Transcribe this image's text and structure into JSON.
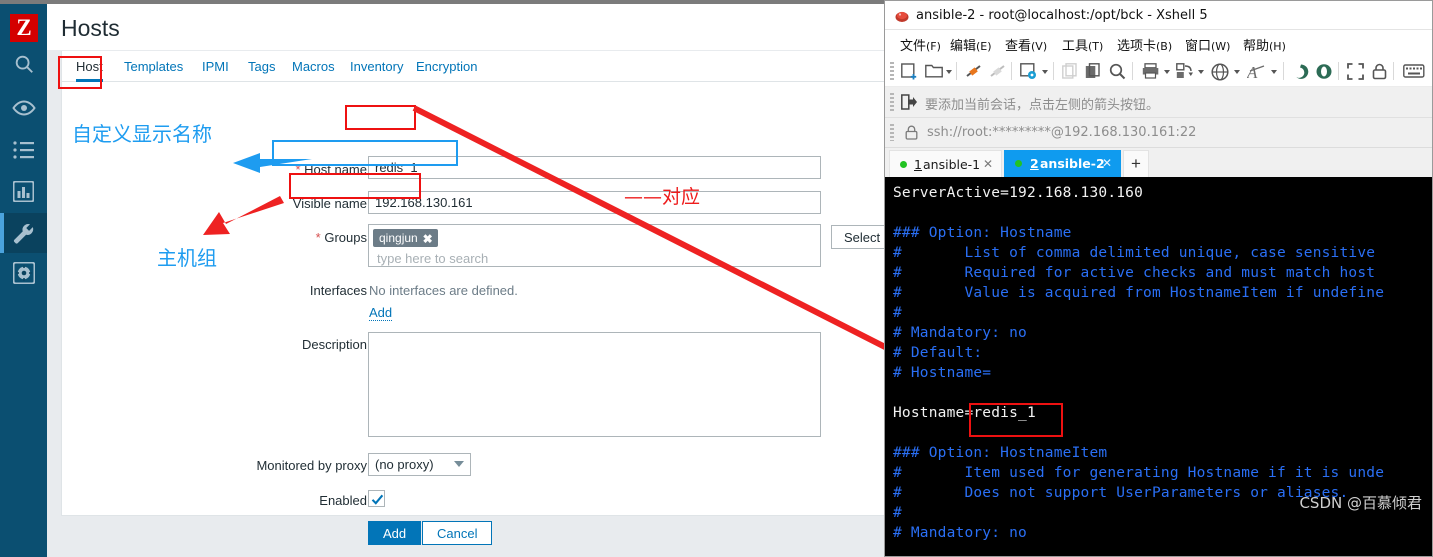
{
  "zabbix": {
    "page_title": "Hosts",
    "logo_text": "Z",
    "sidebar_items": [
      {
        "name": "search-icon",
        "label": "Search"
      },
      {
        "name": "monitoring-eye-icon",
        "label": "Monitoring"
      },
      {
        "name": "list-icon",
        "label": "Inventory"
      },
      {
        "name": "reports-chart-icon",
        "label": "Reports"
      },
      {
        "name": "configuration-wrench-icon",
        "label": "Configuration"
      },
      {
        "name": "administration-gear-icon",
        "label": "Administration"
      }
    ],
    "tabs": [
      {
        "label": "Host",
        "selected": true
      },
      {
        "label": "Templates",
        "selected": false
      },
      {
        "label": "IPMI",
        "selected": false
      },
      {
        "label": "Tags",
        "selected": false
      },
      {
        "label": "Macros",
        "selected": false
      },
      {
        "label": "Inventory",
        "selected": false
      },
      {
        "label": "Encryption",
        "selected": false
      }
    ],
    "form": {
      "host_name_label": "Host name",
      "host_name_value": "redis_1",
      "visible_name_label": "Visible name",
      "visible_name_value": "192.168.130.161",
      "groups_label": "Groups",
      "groups_chip": "qingjun",
      "groups_chip_close": "✖",
      "groups_placeholder": "type here to search",
      "select_button": "Select",
      "interfaces_label": "Interfaces",
      "interfaces_value": "No interfaces are defined.",
      "interfaces_add": "Add",
      "description_label": "Description",
      "description_value": "",
      "proxy_label": "Monitored by proxy",
      "proxy_value": "(no proxy)",
      "proxy_options": [
        "(no proxy)"
      ],
      "enabled_label": "Enabled",
      "enabled_checked": true,
      "add_button": "Add",
      "cancel_button": "Cancel",
      "required_marker": "*"
    },
    "annotations": {
      "custom_display_name": "自定义显示名称",
      "host_group": "主机组",
      "correspond": "——对应"
    },
    "colors": {
      "sidebar_bg": "#0b4f71",
      "accent": "#0275b8",
      "logo_red": "#d40000",
      "anno_blue": "#1e9cf0",
      "anno_red": "#ee1111"
    }
  },
  "xshell": {
    "window_title": "ansible-2 - root@localhost:/opt/bck - Xshell 5",
    "menus": [
      {
        "label": "文件",
        "mnemonic": "(F)"
      },
      {
        "label": "编辑",
        "mnemonic": "(E)"
      },
      {
        "label": "查看",
        "mnemonic": "(V)"
      },
      {
        "label": "工具",
        "mnemonic": "(T)"
      },
      {
        "label": "选项卡",
        "mnemonic": "(B)"
      },
      {
        "label": "窗口",
        "mnemonic": "(W)"
      },
      {
        "label": "帮助",
        "mnemonic": "(H)"
      }
    ],
    "session_hint": "要添加当前会话，点击左侧的箭头按钮。",
    "address": "ssh://root:*********@192.168.130.161:22",
    "tabs": [
      {
        "index": "1",
        "label": "ansible-1",
        "active": false
      },
      {
        "index": "2",
        "label": "ansible-2",
        "active": true
      }
    ],
    "new_tab_label": "+",
    "terminal_lines": [
      {
        "text": "ServerActive=192.168.130.160",
        "color": "white"
      },
      {
        "text": "",
        "color": "white"
      },
      {
        "text": "### Option: Hostname",
        "color": "blue"
      },
      {
        "text": "#       List of comma delimited unique, case sensitive",
        "color": "blue"
      },
      {
        "text": "#       Required for active checks and must match host",
        "color": "blue"
      },
      {
        "text": "#       Value is acquired from HostnameItem if undefine",
        "color": "blue"
      },
      {
        "text": "#",
        "color": "blue"
      },
      {
        "text": "# Mandatory: no",
        "color": "blue"
      },
      {
        "text": "# Default:",
        "color": "blue"
      },
      {
        "text": "# Hostname=",
        "color": "blue"
      },
      {
        "text": "",
        "color": "white"
      },
      {
        "text": "Hostname=redis_1",
        "color": "white"
      },
      {
        "text": "",
        "color": "white"
      },
      {
        "text": "### Option: HostnameItem",
        "color": "blue"
      },
      {
        "text": "#       Item used for generating Hostname if it is unde",
        "color": "blue"
      },
      {
        "text": "#       Does not support UserParameters or aliases.",
        "color": "blue"
      },
      {
        "text": "#",
        "color": "blue"
      },
      {
        "text": "# Mandatory: no",
        "color": "blue"
      }
    ],
    "watermark": "CSDN @百慕倾君"
  }
}
